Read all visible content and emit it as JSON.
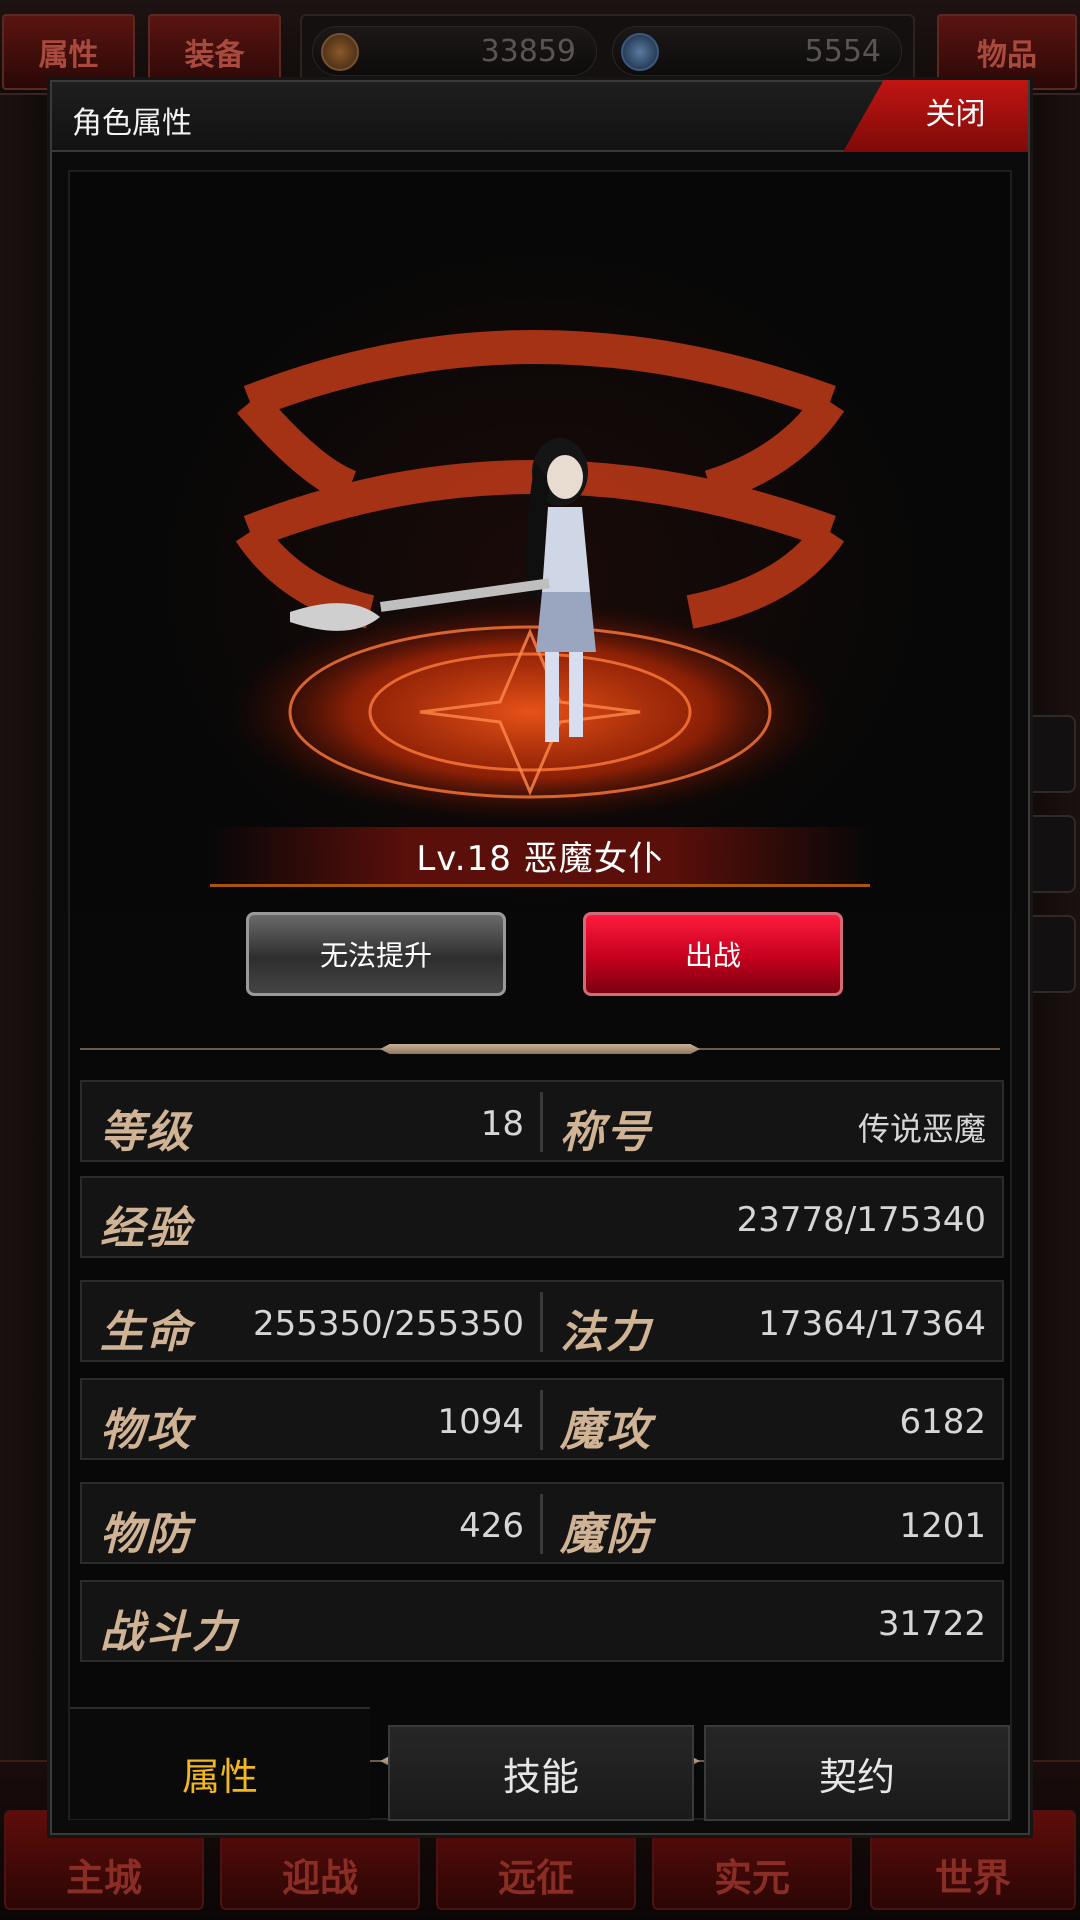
{
  "hud": {
    "tabs": {
      "attributes": "属性",
      "equipment": "装备",
      "items": "物品"
    },
    "resources": {
      "gold": "33859",
      "souls": "5554"
    },
    "nav": [
      "主城",
      "迎战",
      "远征",
      "实元",
      "世界"
    ]
  },
  "dialog": {
    "title": "角色属性",
    "close_label": "关闭",
    "character": {
      "level_name": "Lv.18 恶魔女仆"
    },
    "buttons": {
      "upgrade": "无法提升",
      "deploy": "出战"
    },
    "stats": {
      "level_label": "等级",
      "level_value": "18",
      "title_label": "称号",
      "title_value": "传说恶魔",
      "exp_label": "经验",
      "exp_value": "23778/175340",
      "hp_label": "生命",
      "hp_value": "255350/255350",
      "mp_label": "法力",
      "mp_value": "17364/17364",
      "patk_label": "物攻",
      "patk_value": "1094",
      "matk_label": "魔攻",
      "matk_value": "6182",
      "pdef_label": "物防",
      "pdef_value": "426",
      "mdef_label": "魔防",
      "mdef_value": "1201",
      "power_label": "战斗力",
      "power_value": "31722"
    },
    "tabs": {
      "attributes": "属性",
      "skills": "技能",
      "contract": "契约"
    }
  },
  "colors": {
    "accent_red": "#c4001e",
    "gold_text": "#f2b620",
    "label_tan": "#cfb394"
  }
}
